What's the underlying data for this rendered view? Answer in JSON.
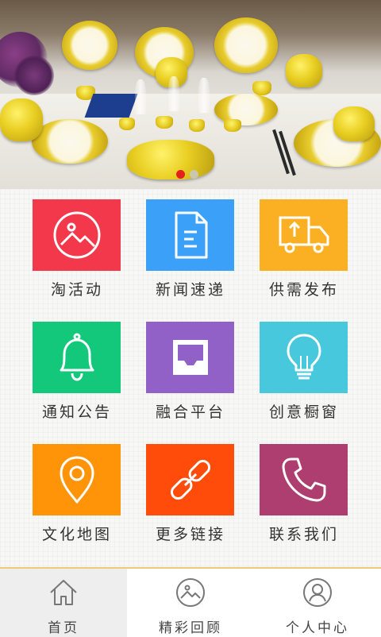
{
  "banner": {
    "slides": 2,
    "active_slide": 1,
    "active_color": "#e61e1e"
  },
  "grid": {
    "items": [
      {
        "label": "淘活动",
        "icon": "picture-icon",
        "color": "#f4384b"
      },
      {
        "label": "新闻速递",
        "icon": "document-icon",
        "color": "#3ba0f7"
      },
      {
        "label": "供需发布",
        "icon": "truck-upload-icon",
        "color": "#fbb023"
      },
      {
        "label": "通知公告",
        "icon": "bell-icon",
        "color": "#13c87b"
      },
      {
        "label": "融合平台",
        "icon": "inbox-icon",
        "color": "#9161c8"
      },
      {
        "label": "创意橱窗",
        "icon": "lightbulb-icon",
        "color": "#47c8dd"
      },
      {
        "label": "文化地图",
        "icon": "map-pin-icon",
        "color": "#ff9408"
      },
      {
        "label": "更多链接",
        "icon": "link-icon",
        "color": "#ff4c0a"
      },
      {
        "label": "联系我们",
        "icon": "phone-icon",
        "color": "#ae3e6f"
      }
    ]
  },
  "tabbar": {
    "tabs": [
      {
        "label": "首页",
        "icon": "home-icon",
        "active": true
      },
      {
        "label": "精彩回顾",
        "icon": "picture-icon",
        "active": false
      },
      {
        "label": "个人中心",
        "icon": "user-icon",
        "active": false
      }
    ],
    "accent": "#f0c87a"
  }
}
